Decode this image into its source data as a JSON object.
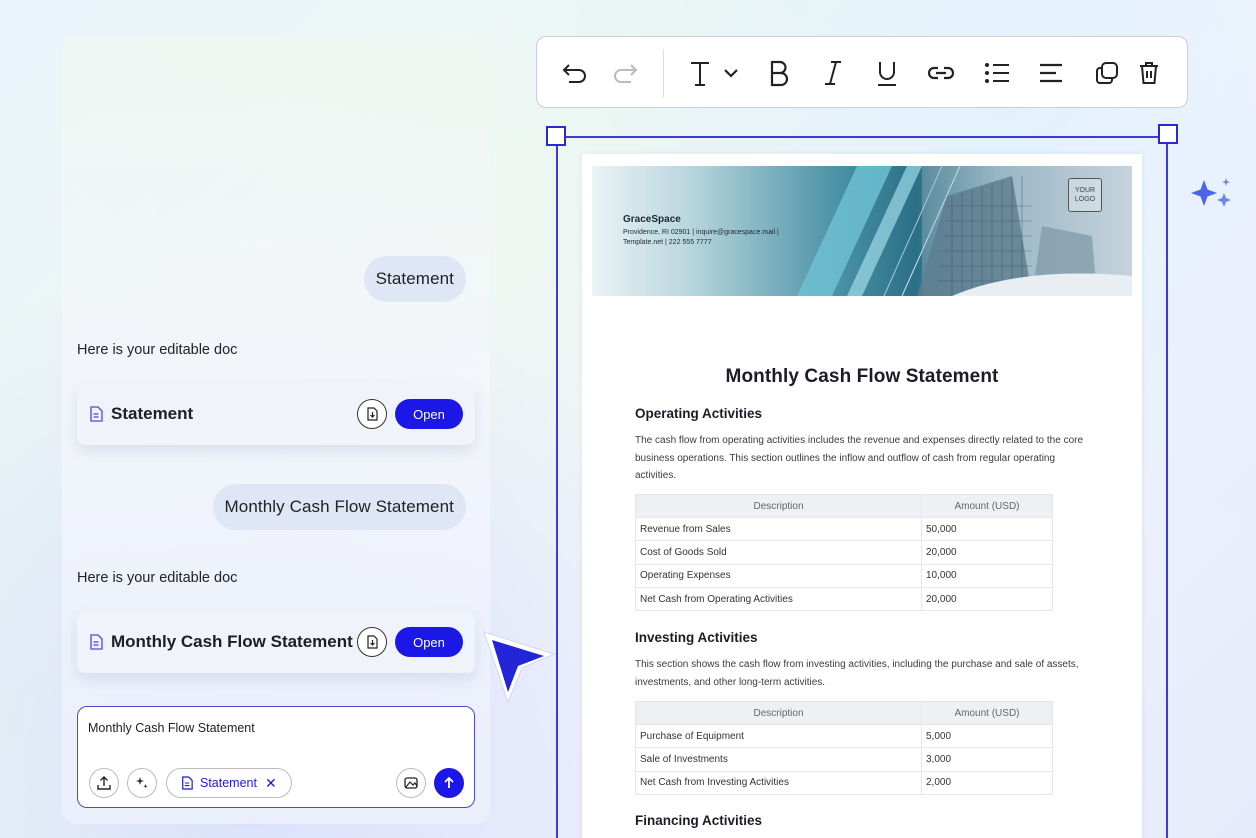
{
  "chat": {
    "messages": [
      {
        "role": "user",
        "text": "Statement"
      },
      {
        "role": "bot",
        "text": "Here is your editable doc"
      },
      {
        "role": "user",
        "text": "Monthly Cash Flow Statement"
      },
      {
        "role": "bot",
        "text": "Here is your editable doc"
      }
    ],
    "cards": [
      {
        "title": "Statement",
        "open_label": "Open",
        "icon": "document-icon",
        "download_icon": "download-icon"
      },
      {
        "title": "Monthly Cash Flow Statement",
        "open_label": "Open",
        "icon": "document-icon",
        "download_icon": "download-icon"
      }
    ],
    "composer": {
      "value": "Monthly Cash Flow Statement",
      "attachment_chip": "Statement",
      "icons": [
        "upload-icon",
        "sparkle-icon",
        "image-icon",
        "send-arrow-icon"
      ]
    }
  },
  "toolbar": {
    "icons": [
      "undo-icon",
      "redo-icon",
      "text-style-icon",
      "bold-icon",
      "italic-icon",
      "underline-icon",
      "link-icon",
      "bullet-list-icon",
      "align-left-icon",
      "duplicate-icon",
      "delete-icon"
    ]
  },
  "document": {
    "banner": {
      "company": "GraceSpace",
      "address_line1": "Providence, RI 02901 | inquire@gracespace.mail |",
      "address_line2": "Template.net | 222 555 7777",
      "logo_text": "YOUR LOGO"
    },
    "title": "Monthly Cash Flow Statement",
    "sections": [
      {
        "heading": "Operating Activities",
        "text": "The cash flow from operating activities includes the revenue and expenses directly related to the core business operations. This section outlines the inflow and outflow of cash from regular operating activities.",
        "headers": [
          "Description",
          "Amount (USD)"
        ],
        "rows": [
          [
            "Revenue from Sales",
            "50,000"
          ],
          [
            "Cost of Goods Sold",
            "20,000"
          ],
          [
            "Operating Expenses",
            "10,000"
          ],
          [
            "Net Cash from Operating Activities",
            "20,000"
          ]
        ]
      },
      {
        "heading": "Investing Activities",
        "text": "This section shows the cash flow from investing activities, including the purchase and sale of assets, investments, and other long-term activities.",
        "headers": [
          "Description",
          "Amount (USD)"
        ],
        "rows": [
          [
            "Purchase of Equipment",
            "5,000"
          ],
          [
            "Sale of Investments",
            "3,000"
          ],
          [
            "Net Cash from Investing Activities",
            "2,000"
          ]
        ]
      },
      {
        "heading": "Financing Activities"
      }
    ]
  },
  "colors": {
    "accent": "#1b17e6",
    "frame": "#3c3bd8",
    "bubble": "#dfe7f6"
  }
}
